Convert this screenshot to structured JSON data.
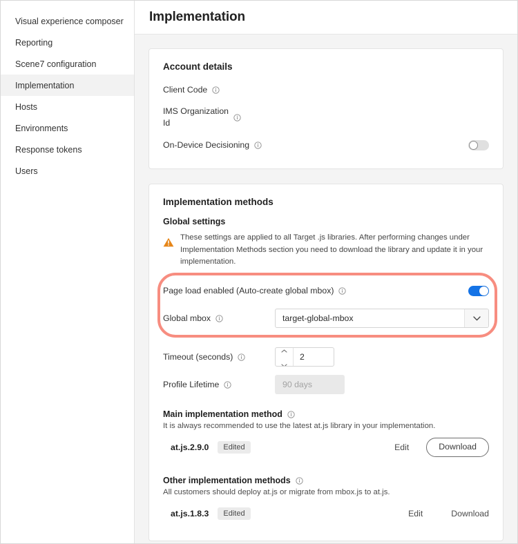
{
  "sidebar": {
    "items": [
      {
        "label": "Visual experience composer",
        "selected": false
      },
      {
        "label": "Reporting",
        "selected": false
      },
      {
        "label": "Scene7 configuration",
        "selected": false
      },
      {
        "label": "Implementation",
        "selected": true
      },
      {
        "label": "Hosts",
        "selected": false
      },
      {
        "label": "Environments",
        "selected": false
      },
      {
        "label": "Response tokens",
        "selected": false
      },
      {
        "label": "Users",
        "selected": false
      }
    ]
  },
  "header": {
    "title": "Implementation"
  },
  "account_details": {
    "title": "Account details",
    "client_code_label": "Client Code",
    "ims_org_label_line1": "IMS Organization",
    "ims_org_label_line2": "Id",
    "on_device_decisioning_label": "On-Device Decisioning",
    "on_device_decisioning_state": "off"
  },
  "implementation_methods": {
    "title": "Implementation methods",
    "global_settings_title": "Global settings",
    "warning_text": "These settings are applied to all Target .js libraries. After performing changes under Implementation Methods section you need to download the library and update it in your implementation.",
    "page_load_label": "Page load enabled (Auto-create global mbox)",
    "page_load_state": "on",
    "global_mbox_label": "Global mbox",
    "global_mbox_value": "target-global-mbox",
    "timeout_label": "Timeout (seconds)",
    "timeout_value": "2",
    "profile_lifetime_label": "Profile Lifetime",
    "profile_lifetime_value": "90 days",
    "main_method": {
      "heading": "Main implementation method",
      "description": "It is always recommended to use the latest at.js library in your implementation.",
      "name": "at.js.2.9.0",
      "badge": "Edited",
      "edit_label": "Edit",
      "download_label": "Download"
    },
    "other_methods": {
      "heading": "Other implementation methods",
      "description": "All customers should deploy at.js or migrate from mbox.js to at.js.",
      "name": "at.js.1.8.3",
      "badge": "Edited",
      "edit_label": "Edit",
      "download_label": "Download"
    }
  },
  "colors": {
    "accent_blue": "#1473e6",
    "highlight_ring": "#f78d80",
    "warning_orange": "#e68619",
    "selected_nav_bg": "#f2f2f2"
  }
}
